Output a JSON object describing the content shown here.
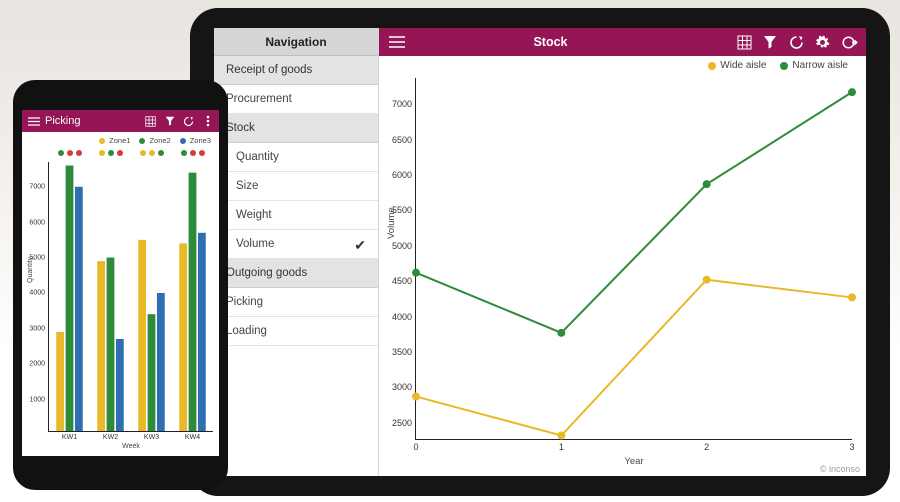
{
  "tablet": {
    "nav_header": "Navigation",
    "sidebar": {
      "receipt": "Receipt of goods",
      "procurement": "Procurement",
      "stock": "Stock",
      "quantity": "Quantity",
      "size": "Size",
      "weight": "Weight",
      "volume": "Volume",
      "outgoing": "Outgoing goods",
      "picking": "Picking",
      "loading": "Loading"
    },
    "header": {
      "title": "Stock",
      "menu_icon": "menu-icon",
      "grid_icon": "grid-icon",
      "filter_icon": "filter-icon",
      "refresh_icon": "refresh-icon",
      "gear_icon": "gear-icon",
      "logout_icon": "logout-icon"
    },
    "legend": {
      "wide": "Wide aisle",
      "narrow": "Narrow aisle"
    },
    "ylabel": "Volume",
    "xlabel": "Year",
    "footer": "© inconso"
  },
  "phone": {
    "header": {
      "title": "Picking",
      "menu_icon": "menu-icon",
      "grid_icon": "grid-icon",
      "filter_icon": "filter-icon",
      "refresh_icon": "refresh-icon",
      "more_icon": "more-icon"
    },
    "legend": {
      "zone1": "Zone1",
      "zone2": "Zone2",
      "zone3": "Zone3"
    },
    "ylabel": "Quantity",
    "xlabel": "Week"
  },
  "colors": {
    "accent": "#951556",
    "wide": "#e9b92a",
    "narrow": "#2e8b3b",
    "zone1": "#e9b92a",
    "zone2": "#2e8b3b",
    "zone3": "#2e6fb3",
    "status_red": "#d83a3a"
  },
  "chart_data": [
    {
      "id": "tablet_line",
      "type": "line",
      "title": "Stock",
      "xlabel": "Year",
      "ylabel": "Volume",
      "x": [
        0,
        1,
        2,
        3
      ],
      "yticks": [
        2500,
        3000,
        3500,
        4000,
        4500,
        5000,
        5500,
        6000,
        6500,
        7000
      ],
      "ylim": [
        2200,
        7300
      ],
      "series": [
        {
          "name": "Wide aisle",
          "color": "#e9b92a",
          "values": [
            2800,
            2250,
            4450,
            4200
          ]
        },
        {
          "name": "Narrow aisle",
          "color": "#2e8b3b",
          "values": [
            4550,
            3700,
            5800,
            7100
          ]
        }
      ]
    },
    {
      "id": "phone_bar",
      "type": "bar",
      "title": "Picking",
      "xlabel": "Week",
      "ylabel": "Quantity",
      "categories": [
        "KW1",
        "KW2",
        "KW3",
        "KW4"
      ],
      "yticks": [
        1000,
        2000,
        3000,
        4000,
        5000,
        6000,
        7000
      ],
      "ylim": [
        0,
        7600
      ],
      "series": [
        {
          "name": "Zone1",
          "color": "#e9b92a",
          "values": [
            2800,
            4800,
            5400,
            5300
          ]
        },
        {
          "name": "Zone2",
          "color": "#2e8b3b",
          "values": [
            7500,
            4900,
            3300,
            7300
          ]
        },
        {
          "name": "Zone3",
          "color": "#2e6fb3",
          "values": [
            6900,
            2600,
            3900,
            5600
          ]
        }
      ],
      "status_dots": {
        "KW1": [
          "#2e8b3b",
          "#d83a3a",
          "#d83a3a"
        ],
        "KW2": [
          "#e9b92a",
          "#2e8b3b",
          "#d83a3a"
        ],
        "KW3": [
          "#e9b92a",
          "#e9b92a",
          "#2e8b3b"
        ],
        "KW4": [
          "#2e8b3b",
          "#d83a3a",
          "#d83a3a"
        ]
      }
    }
  ]
}
